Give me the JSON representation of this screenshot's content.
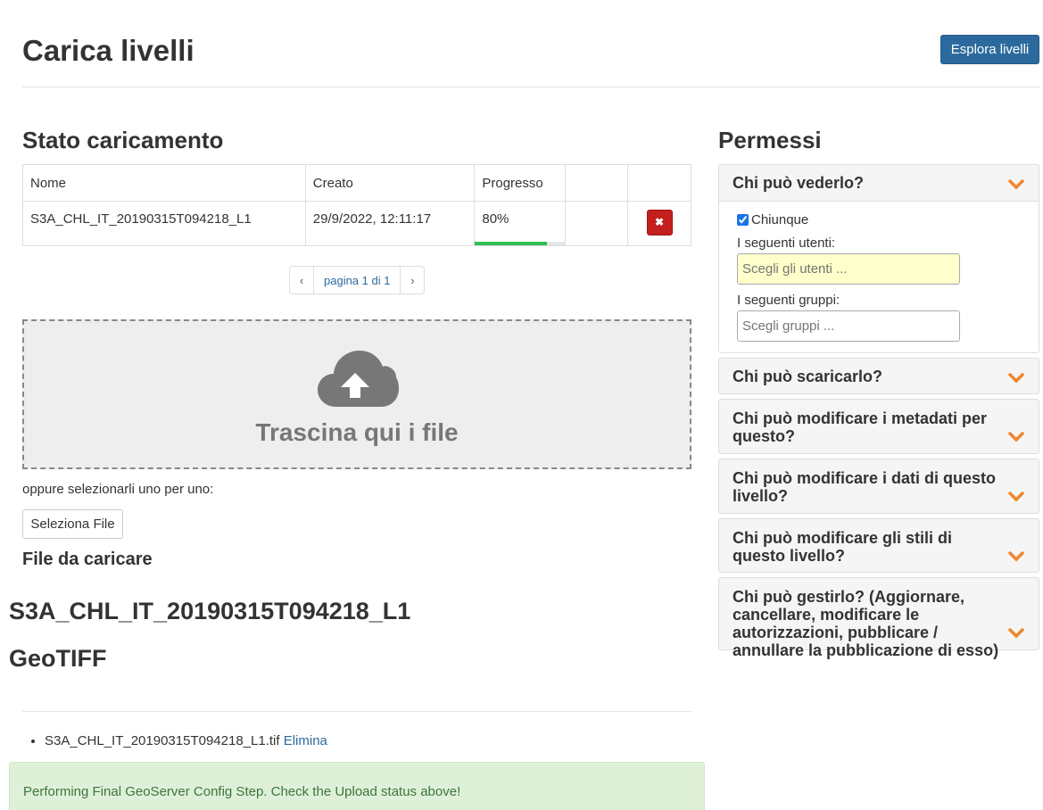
{
  "header": {
    "title": "Carica livelli",
    "explore_label": "Esplora livelli"
  },
  "upload_status": {
    "heading": "Stato caricamento",
    "columns": [
      "Nome",
      "Creato",
      "Progresso",
      "",
      ""
    ],
    "rows": [
      {
        "name": "S3A_CHL_IT_20190315T094218_L1",
        "created": "29/9/2022, 12:11:17",
        "progress_text": "80%",
        "progress_fraction": 0.8,
        "delete_icon": "✖"
      }
    ],
    "pagination": {
      "prev": "‹",
      "label": "pagina 1 di 1",
      "next": "›"
    }
  },
  "dropzone": {
    "icon": "cloud-upload-icon",
    "text": "Trascina qui i file"
  },
  "file_select": {
    "or_text": "oppure selezionarli uno per uno:",
    "button_label": "Seleziona File"
  },
  "files": {
    "heading": "File da caricare",
    "name": "S3A_CHL_IT_20190315T094218_L1",
    "type": "GeoTIFF",
    "items": [
      {
        "filename": "S3A_CHL_IT_20190315T094218_L1.tif",
        "delete_label": "Elimina"
      }
    ]
  },
  "alert": {
    "message": "Performing Final GeoServer Config Step. Check the Upload status above!"
  },
  "permissions": {
    "heading": "Permessi",
    "view": {
      "title": "Chi può vederlo?",
      "anyone_label": "Chiunque",
      "anyone_checked": true,
      "users_label": "I seguenti utenti:",
      "users_placeholder": "Scegli gli utenti ...",
      "groups_label": "I seguenti gruppi:",
      "groups_placeholder": "Scegli gruppi ..."
    },
    "panels": [
      {
        "title": "Chi può scaricarlo?"
      },
      {
        "title": "Chi può modificare i metadati per questo?"
      },
      {
        "title": "Chi può modificare i dati di questo livello?"
      },
      {
        "title": "Chi può modificare gli stili di questo livello?"
      },
      {
        "title": "Chi può gestirlo? (Aggiornare, cancellare, modificare le autorizzazioni, pubblicare / annullare la pubblicazione di esso)"
      }
    ]
  },
  "colors": {
    "primary": "#2c6a9d",
    "danger": "#c41f1f",
    "progress": "#2ec052",
    "chevron": "#f0862e",
    "success_bg": "#dff0d8"
  }
}
